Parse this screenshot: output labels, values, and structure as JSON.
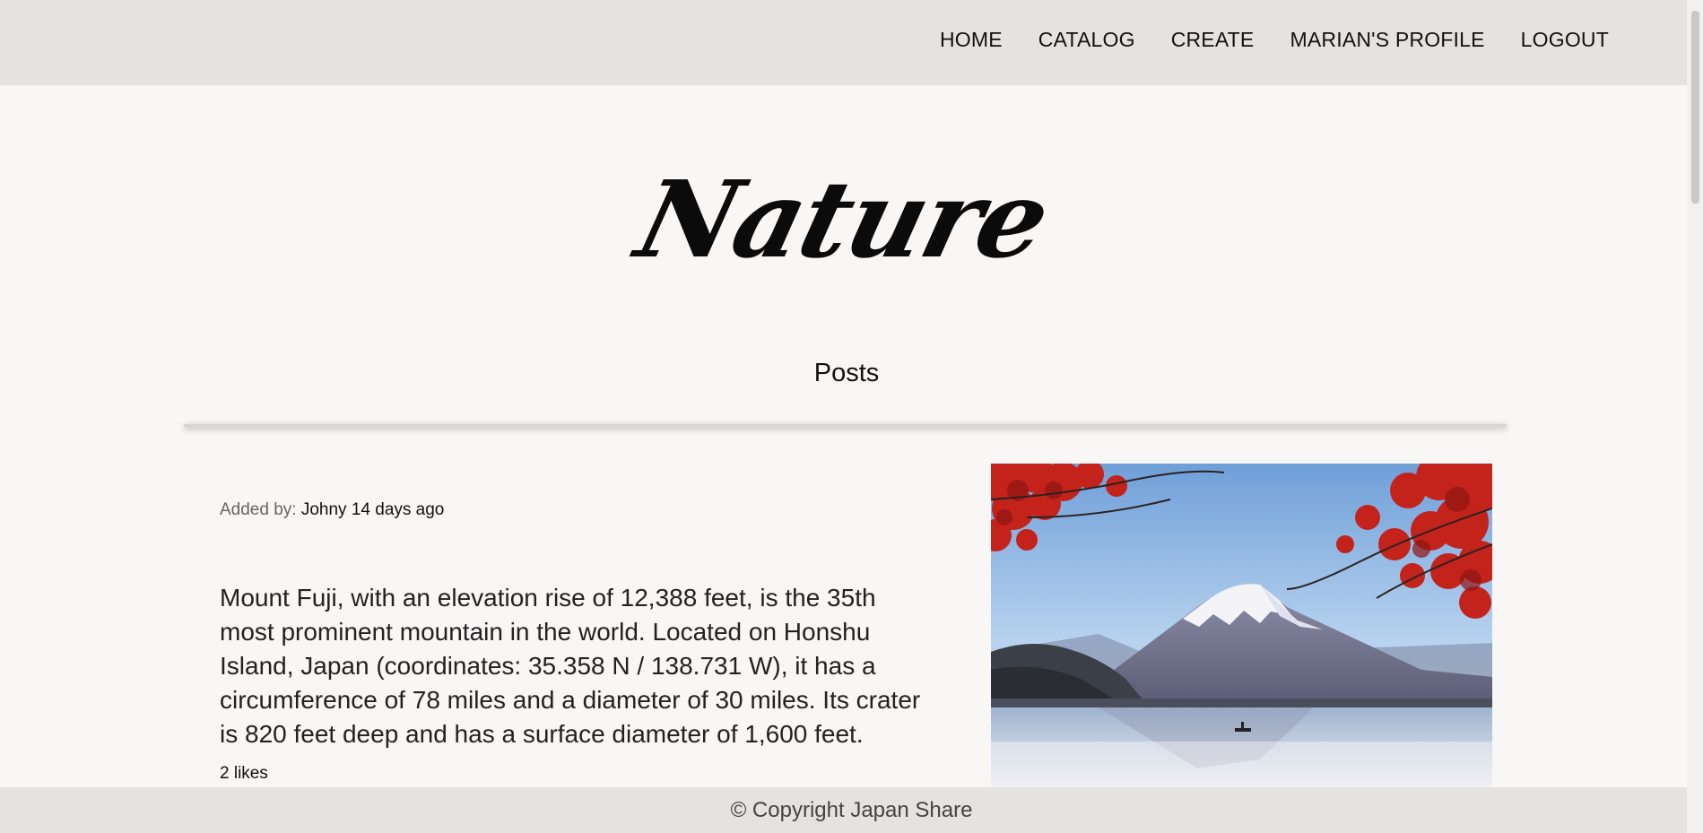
{
  "nav": {
    "home": "HOME",
    "catalog": "CATALOG",
    "create": "CREATE",
    "profile": "MARIAN'S PROFILE",
    "logout": "LOGOUT"
  },
  "hero": {
    "title": "Nature"
  },
  "section": {
    "heading": "Posts"
  },
  "post": {
    "added_by_label": "Added by:",
    "author_and_time": "Johny 14 days ago",
    "text": "Mount Fuji, with an elevation rise of 12,388 feet, is the 35th most prominent mountain in the world. Located on Honshu Island, Japan (coordinates: 35.358 N / 138.731 W), it has a circumference of 78 miles and a diameter of 30 miles. Its crater is 820 feet deep and has a surface diameter of 1,600 feet.",
    "likes": "2 likes"
  },
  "footer": {
    "text": "© Copyright Japan Share"
  },
  "colors": {
    "bar": "#e4e3e1",
    "background": "#f9f6f6",
    "maple_red": "#c4231c",
    "sky": "#9fc3ea"
  }
}
